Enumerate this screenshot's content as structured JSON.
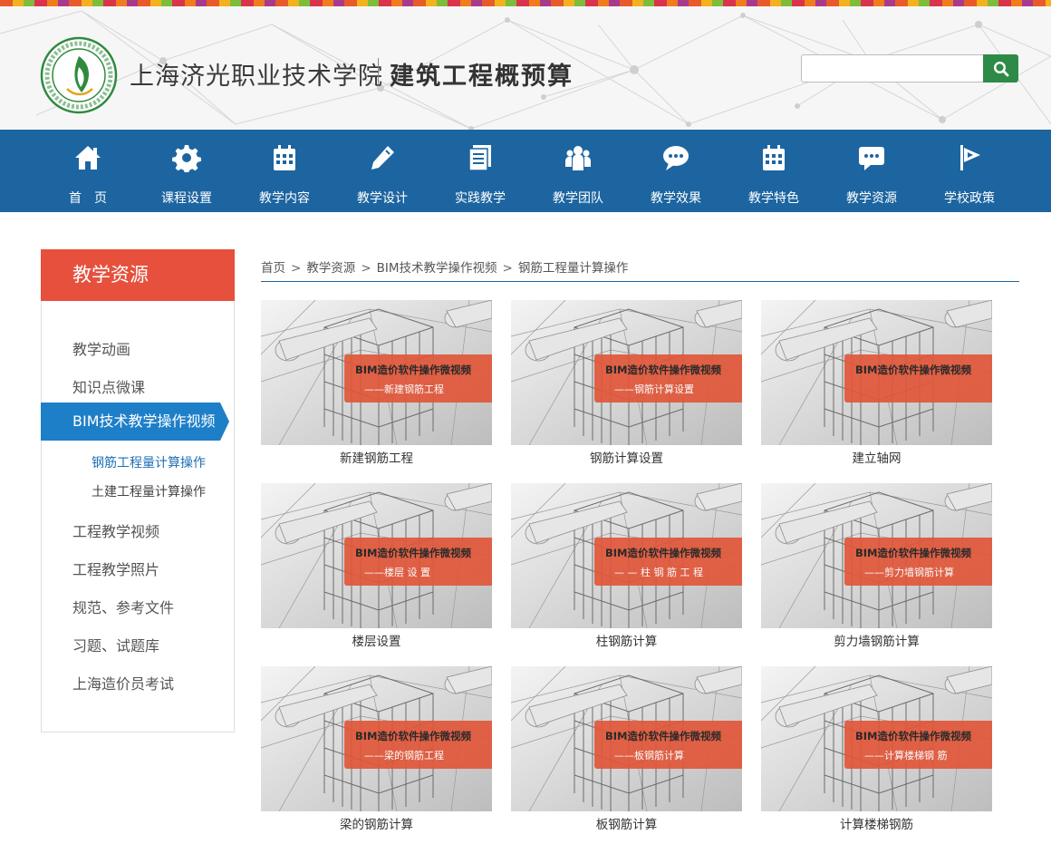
{
  "header": {
    "school_name": "上海济光职业技术学院",
    "course_name": "建筑工程概预算",
    "search_placeholder": ""
  },
  "nav": [
    {
      "label": "首　页",
      "icon": "home-icon"
    },
    {
      "label": "课程设置",
      "icon": "gear-icon"
    },
    {
      "label": "教学内容",
      "icon": "calendar-icon"
    },
    {
      "label": "教学设计",
      "icon": "pencil-icon"
    },
    {
      "label": "实践教学",
      "icon": "document-icon"
    },
    {
      "label": "教学团队",
      "icon": "team-icon"
    },
    {
      "label": "教学效果",
      "icon": "chat-bubble-icon"
    },
    {
      "label": "教学特色",
      "icon": "calendar-icon"
    },
    {
      "label": "教学资源",
      "icon": "message-icon"
    },
    {
      "label": "学校政策",
      "icon": "flag-icon"
    }
  ],
  "sidebar": {
    "title": "教学资源",
    "items": [
      {
        "label": "教学动画"
      },
      {
        "label": "知识点微课"
      },
      {
        "label": "BIM技术教学操作视频"
      },
      {
        "label": "工程教学视频"
      },
      {
        "label": "工程教学照片"
      },
      {
        "label": "规范、参考文件"
      },
      {
        "label": "习题、试题库"
      },
      {
        "label": "上海造价员考试"
      }
    ],
    "sub_items": [
      {
        "label": "钢筋工程量计算操作"
      },
      {
        "label": "土建工程量计算操作"
      }
    ]
  },
  "breadcrumb": [
    "首页",
    "教学资源",
    "BIM技术教学操作视频",
    "钢筋工程量计算操作"
  ],
  "videos": [
    {
      "banner_title": "BIM造价软件操作微视频",
      "banner_sub": "——新建钢筋工程",
      "caption": "新建钢筋工程"
    },
    {
      "banner_title": "BIM造价软件操作微视频",
      "banner_sub": "——钢筋计算设置",
      "caption": "钢筋计算设置"
    },
    {
      "banner_title": "BIM造价软件操作微视频",
      "banner_sub": "",
      "caption": "建立轴网"
    },
    {
      "banner_title": "BIM造价软件操作微视频",
      "banner_sub": "——楼层 设 置",
      "caption": "楼层设置"
    },
    {
      "banner_title": "BIM造价软件操作微视频",
      "banner_sub": "— — 柱 钢 筋 工 程",
      "caption": "柱钢筋计算"
    },
    {
      "banner_title": "BIM造价软件操作微视频",
      "banner_sub": "——剪力墙钢筋计算",
      "caption": "剪力墙钢筋计算"
    },
    {
      "banner_title": "BIM造价软件操作微视频",
      "banner_sub": "——梁的钢筋工程",
      "caption": "梁的钢筋计算"
    },
    {
      "banner_title": "BIM造价软件操作微视频",
      "banner_sub": "——板钢筋计算",
      "caption": "板钢筋计算"
    },
    {
      "banner_title": "BIM造价软件操作微视频",
      "banner_sub": "——计算楼梯钢 筋",
      "caption": "计算楼梯钢筋"
    }
  ],
  "colors": {
    "nav_bg": "#1d65a0",
    "sidebar_title_bg": "#e6503c",
    "sidebar_active_bg": "#1e7fc9",
    "search_button": "#2e8b47",
    "banner": "#e1573a"
  }
}
